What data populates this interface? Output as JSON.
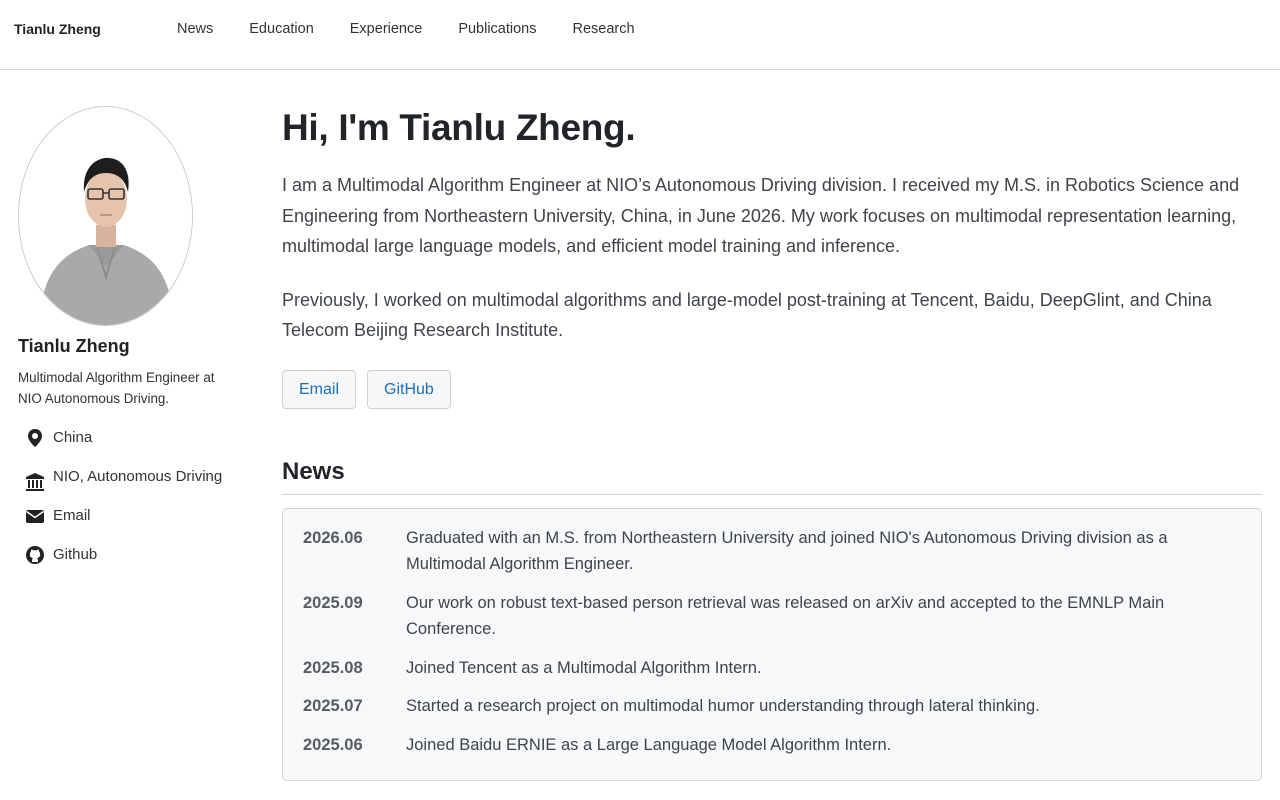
{
  "nav": {
    "brand": "Tianlu Zheng",
    "links": [
      "News",
      "Education",
      "Experience",
      "Publications",
      "Research"
    ]
  },
  "sidebar": {
    "name": "Tianlu Zheng",
    "bio": "Multimodal Algorithm Engineer at NIO Autonomous Driving.",
    "items": [
      {
        "icon": "location-pin-icon",
        "label": "China"
      },
      {
        "icon": "institution-icon",
        "label": "NIO, Autonomous Driving"
      },
      {
        "icon": "envelope-icon",
        "label": "Email"
      },
      {
        "icon": "github-icon",
        "label": "Github"
      }
    ]
  },
  "main": {
    "heading": "Hi, I'm Tianlu Zheng.",
    "para1": "I am a Multimodal Algorithm Engineer at NIO’s Autonomous Driving division. I received my M.S. in Robotics Science and Engineering from Northeastern University, China, in June 2026. My work focuses on multimodal representation learning, multimodal large language models, and efficient model training and inference.",
    "para2": "Previously, I worked on multimodal algorithms and large-model post-training at Tencent, Baidu, DeepGlint, and China Telecom Beijing Research Institute.",
    "buttons": [
      "Email",
      "GitHub"
    ]
  },
  "news": {
    "title": "News",
    "items": [
      {
        "date": "2026.06",
        "text": "Graduated with an M.S. from Northeastern University and joined NIO's Autonomous Driving division as a Multimodal Algorithm Engineer."
      },
      {
        "date": "2025.09",
        "text": "Our work on robust text-based person retrieval was released on arXiv and accepted to the EMNLP Main Conference."
      },
      {
        "date": "2025.08",
        "text": "Joined Tencent as a Multimodal Algorithm Intern."
      },
      {
        "date": "2025.07",
        "text": "Started a research project on multimodal humor understanding through lateral thinking."
      },
      {
        "date": "2025.06",
        "text": "Joined Baidu ERNIE as a Large Language Model Algorithm Intern."
      }
    ]
  },
  "colors": {
    "link": "#1d6fb8",
    "news_bg": "#f6f8fa",
    "border": "#d0d6dc"
  }
}
